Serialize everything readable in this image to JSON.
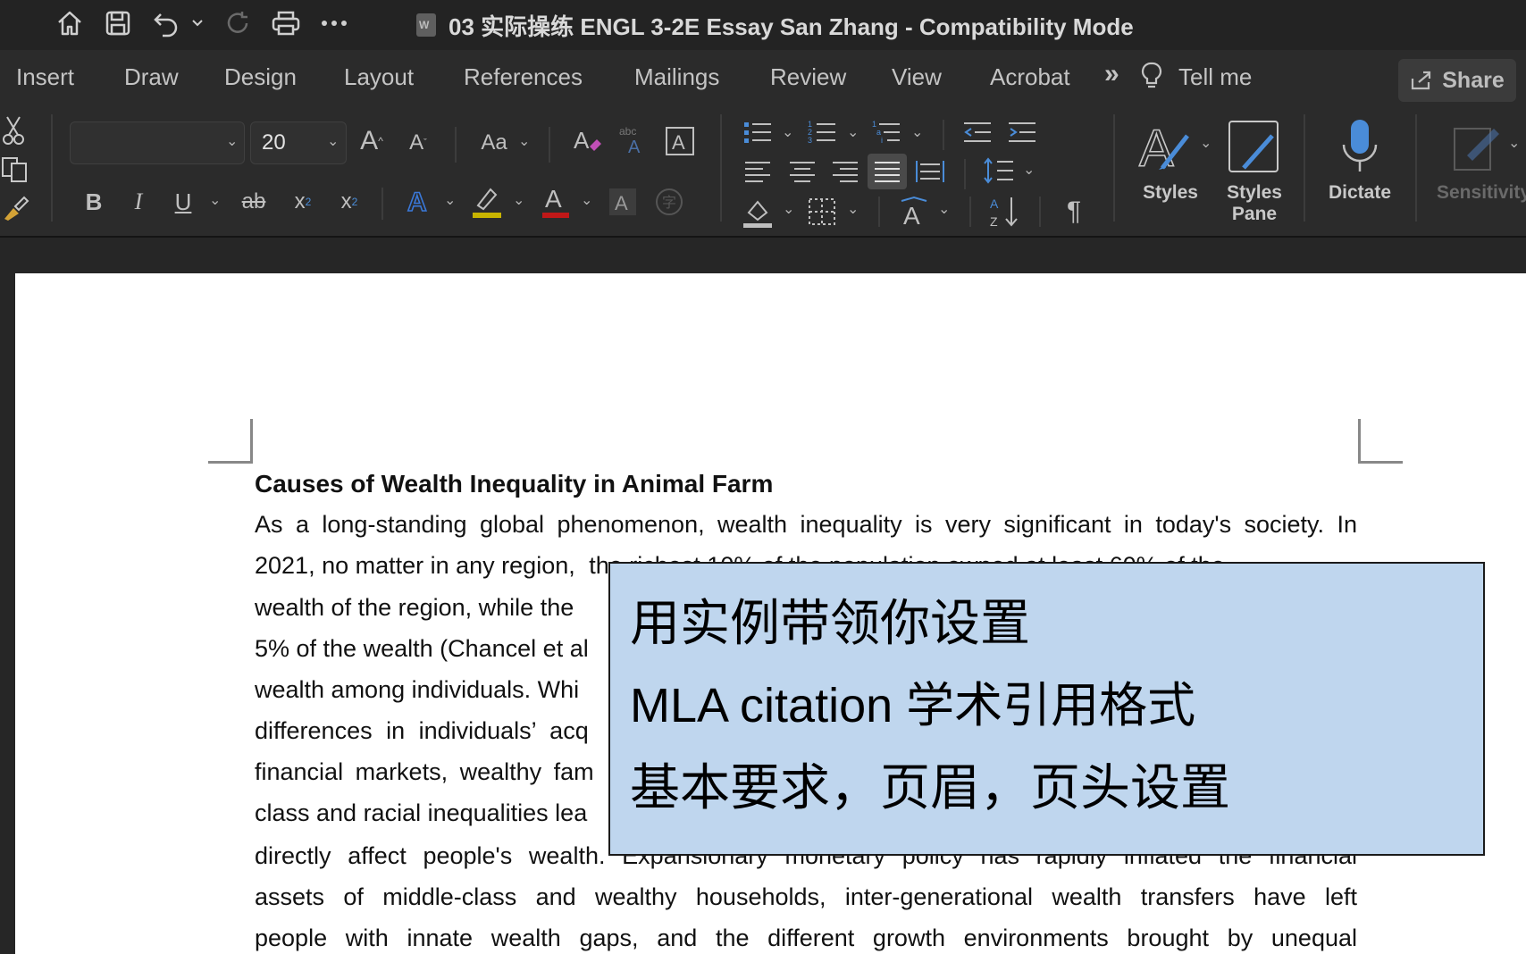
{
  "titlebar": {
    "title": "03 实际操练 ENGL 3-2E Essay San Zhang  -  Compatibility Mode",
    "icons": [
      "home-icon",
      "save-icon",
      "undo-icon",
      "redo-icon",
      "print-icon",
      "more-icon"
    ]
  },
  "tabs": {
    "items": [
      "Insert",
      "Draw",
      "Design",
      "Layout",
      "References",
      "Mailings",
      "Review",
      "View",
      "Acrobat"
    ],
    "more": "»",
    "tell_me": "Tell me",
    "share": "Share"
  },
  "ribbon": {
    "font_name": "",
    "font_size": "20",
    "change_case": "Aa",
    "styles_label": "Styles",
    "styles_pane_label": "Styles\nPane",
    "dictate_label": "Dictate",
    "sensitivity_label": "Sensitivity",
    "colors": {
      "highlight": "#c8b400",
      "font_color": "#c01818",
      "text_effects": "#3a78d8"
    }
  },
  "document": {
    "title": "Causes of Wealth Inequality in Animal Farm",
    "lines": [
      "As a long-standing global phenomenon, wealth inequality is very significant in today's society. In",
      "2021, no matter in any region,",
      "wealth of the region, while the",
      "5% of the wealth (Chancel et al",
      "wealth among individuals. Whi",
      "differences in individuals’ acq",
      "financial markets, wealthy fam",
      "class and racial inequalities lea",
      "directly affect people's wealth. Expansionary monetary policy has rapidly inflated the financial",
      "assets of middle-class and wealthy households, inter-generational wealth transfers have left",
      "people with innate wealth gaps, and the different growth environments brought by unequal"
    ],
    "partial_fragment": "the richest 10% of the population owned at least 60% of the"
  },
  "callout": {
    "line1": "用实例带领你设置",
    "line2": "MLA citation  学术引用格式",
    "line3": "基本要求，页眉，页头设置"
  }
}
